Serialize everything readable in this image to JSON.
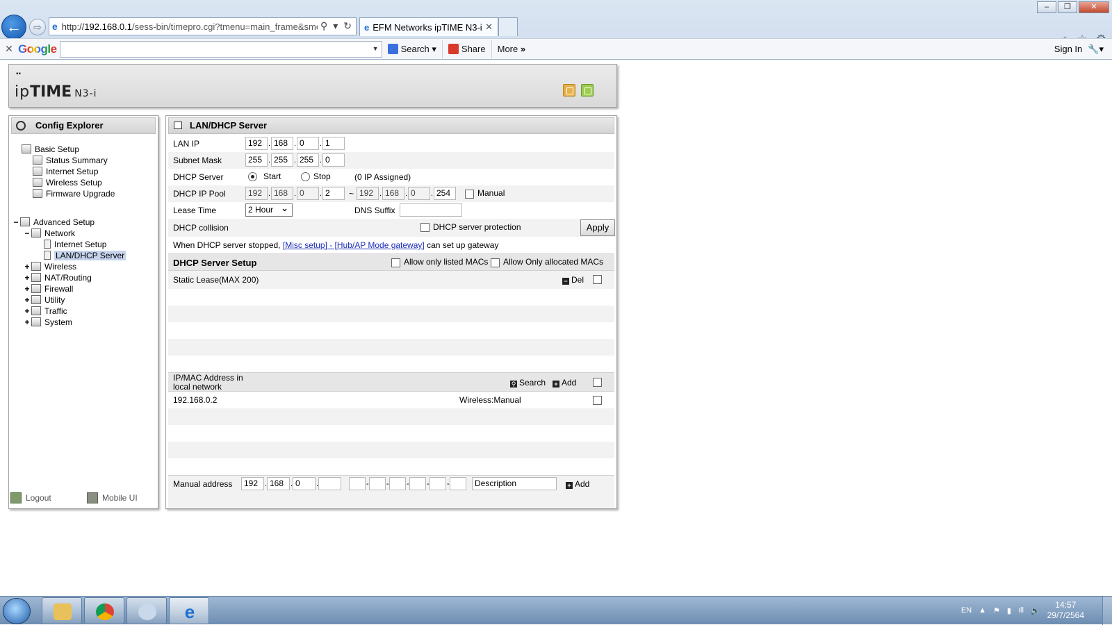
{
  "browser": {
    "url_prefix": "http://",
    "url_host": "192.168.0.1",
    "url_rest": "/sess-bin/timepro.cgi?tmenu=main_frame&smenu",
    "tab_title": "EFM Networks ipTIME N3-i",
    "google_logo": "Google",
    "toolbar": {
      "search": "Search",
      "share": "Share",
      "more": "More",
      "sign_in": "Sign In"
    }
  },
  "header": {
    "logo_prefix": "ip",
    "logo_strong": "TIME",
    "logo_model": "N3-i"
  },
  "sidebar": {
    "title": "Config Explorer",
    "basic": {
      "label": "Basic Setup",
      "items": [
        "Status Summary",
        "Internet Setup",
        "Wireless Setup",
        "Firmware Upgrade"
      ]
    },
    "advanced": {
      "label": "Advanced Setup",
      "network": "Network",
      "network_items": [
        "Internet Setup",
        "LAN/DHCP Server"
      ],
      "groups": [
        "Wireless",
        "NAT/Routing",
        "Firewall",
        "Utility",
        "Traffic",
        "System"
      ]
    },
    "logout": "Logout",
    "mobile_ui": "Mobile UI"
  },
  "main": {
    "title": "LAN/DHCP Server",
    "lan_ip": {
      "label": "LAN IP",
      "octets": [
        "192",
        "168",
        "0",
        "1"
      ]
    },
    "subnet": {
      "label": "Subnet Mask",
      "octets": [
        "255",
        "255",
        "255",
        "0"
      ]
    },
    "dhcp_server": {
      "label": "DHCP Server",
      "start": "Start",
      "stop": "Stop",
      "status": "(0 IP Assigned)",
      "selected": "Start"
    },
    "pool": {
      "label": "DHCP IP Pool",
      "start": [
        "192",
        "168",
        "0",
        "2"
      ],
      "tilde": "~",
      "end": [
        "192",
        "168",
        "0",
        "254"
      ],
      "manual": "Manual"
    },
    "lease": {
      "label": "Lease Time",
      "value": "2 Hour",
      "dns_label": "DNS Suffix",
      "dns_value": ""
    },
    "collision": {
      "label": "DHCP collision",
      "protection": "DHCP server protection",
      "apply": "Apply"
    },
    "note": {
      "before": "When DHCP server stopped, ",
      "link": "[Misc setup] - [Hub/AP Mode gateway]",
      "after": " can set up gateway"
    },
    "setup": {
      "title": "DHCP Server Setup",
      "allow_listed": "Allow only listed MACs",
      "allow_allocated": "Allow Only allocated MACs"
    },
    "static_lease": {
      "label": "Static Lease(MAX 200)",
      "del": "Del"
    },
    "local_network": {
      "label": "IP/MAC Address in local network",
      "search": "Search",
      "add": "Add",
      "entries": [
        {
          "ip": "192.168.0.2",
          "type": "Wireless:Manual"
        }
      ]
    },
    "manual_address": {
      "label": "Manual address",
      "octets": [
        "192",
        "168",
        "0",
        ""
      ],
      "description_placeholder": "Description",
      "add": "Add"
    }
  },
  "taskbar": {
    "lang": "EN",
    "time": "14:57",
    "date": "29/7/2564"
  },
  "colors": {
    "link": "#1c2eb8",
    "selected": "#c5d3ec",
    "panel_header": "#d4d4d4"
  }
}
